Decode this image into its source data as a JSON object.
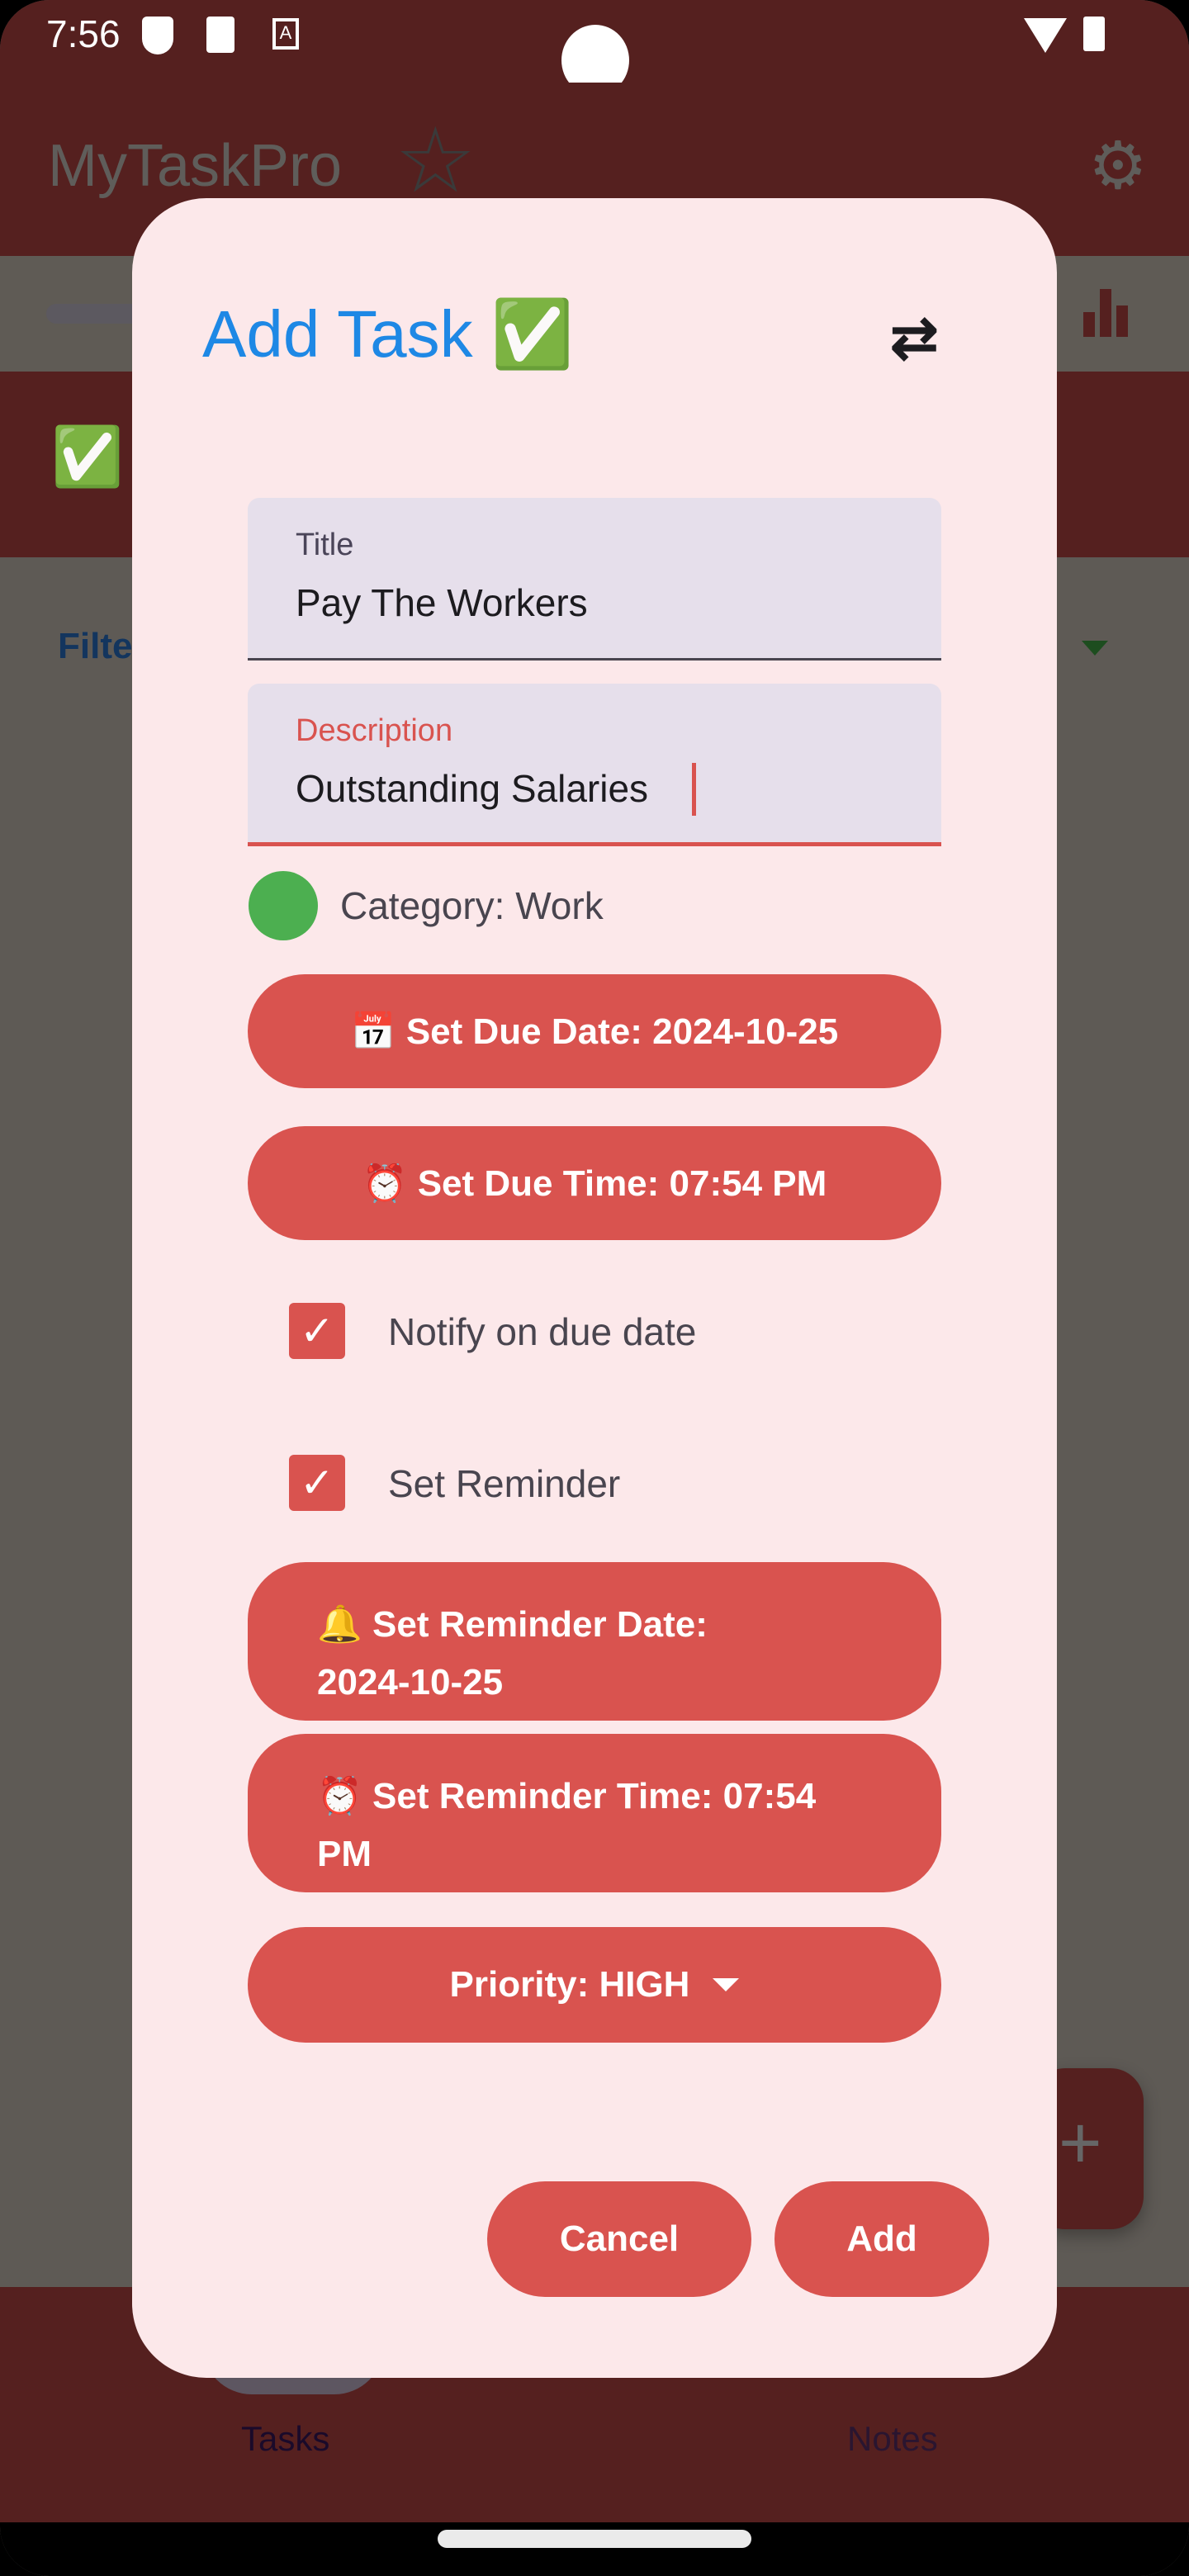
{
  "status_bar": {
    "time": "7:56"
  },
  "app_bar": {
    "title": "MyTaskPro"
  },
  "background": {
    "filter_label": "Filter",
    "nav": {
      "tasks": "Tasks",
      "notes": "Notes"
    }
  },
  "dialog": {
    "title": "Add Task ✅",
    "title_field": {
      "label": "Title",
      "value": "Pay The Workers"
    },
    "description_field": {
      "label": "Description",
      "value": "Outstanding Salaries"
    },
    "category": {
      "label": "Category: Work",
      "color": "#4caf50"
    },
    "due_date_button": "📅 Set Due Date: 2024-10-25",
    "due_time_button": "⏰ Set Due Time: 07:54 PM",
    "notify_checkbox": {
      "label": "Notify on due date",
      "checked": true
    },
    "reminder_checkbox": {
      "label": "Set Reminder",
      "checked": true
    },
    "reminder_date_button": "🔔 Set Reminder Date: 2024-10-25",
    "reminder_time_button": "⏰ Set Reminder Time: 07:54 PM",
    "priority_button": "Priority: HIGH",
    "cancel_button": "Cancel",
    "add_button": "Add"
  },
  "colors": {
    "accent": "#d9534f",
    "title": "#1e88e5",
    "primary_dark": "#55201f",
    "dialog_bg": "#fce8ea"
  }
}
